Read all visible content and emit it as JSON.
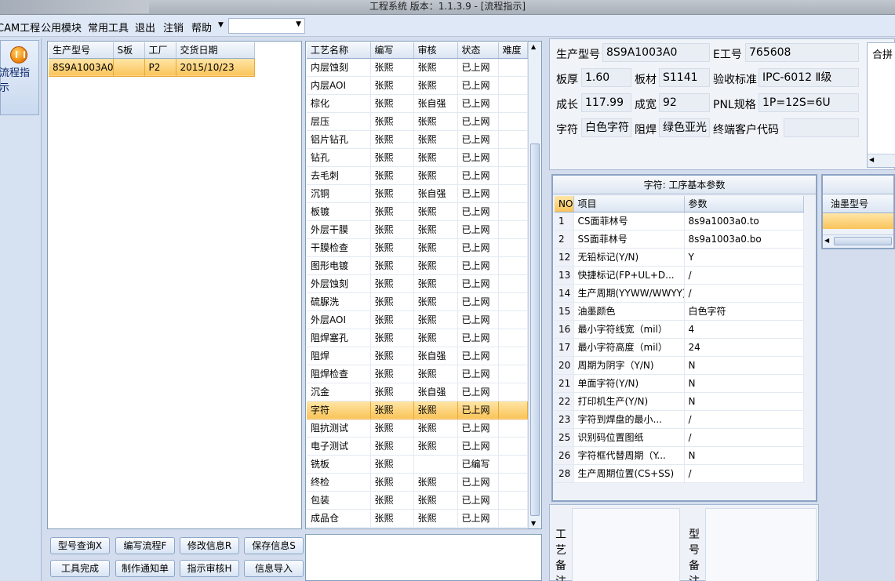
{
  "window": {
    "title": "工程系统   版本：1.1.3.9 - [流程指示]"
  },
  "menu": {
    "items": [
      "CAM工程",
      "公用模块",
      "常用工具",
      "退出",
      "注销",
      "帮助"
    ],
    "combo_value": ""
  },
  "nav": {
    "flow_label": "流程指示"
  },
  "models": {
    "headers": [
      "生产型号",
      "S板",
      "工厂",
      "交货日期"
    ],
    "rows": [
      {
        "model": "8S9A1003A0",
        "s": "",
        "factory": "P2",
        "date": "2015/10/23"
      }
    ]
  },
  "process": {
    "headers": [
      "工艺名称",
      "编写",
      "审核",
      "状态",
      "难度"
    ],
    "selected_index": 19,
    "rows": [
      [
        "内层蚀刻",
        "张熙",
        "张熙",
        "已上网",
        ""
      ],
      [
        "内层AOI",
        "张熙",
        "张熙",
        "已上网",
        ""
      ],
      [
        "棕化",
        "张熙",
        "张自强",
        "已上网",
        ""
      ],
      [
        "层压",
        "张熙",
        "张熙",
        "已上网",
        ""
      ],
      [
        "铝片钻孔",
        "张熙",
        "张熙",
        "已上网",
        ""
      ],
      [
        "钻孔",
        "张熙",
        "张熙",
        "已上网",
        ""
      ],
      [
        "去毛刺",
        "张熙",
        "张熙",
        "已上网",
        ""
      ],
      [
        "沉铜",
        "张熙",
        "张自强",
        "已上网",
        ""
      ],
      [
        "板镀",
        "张熙",
        "张熙",
        "已上网",
        ""
      ],
      [
        "外层干膜",
        "张熙",
        "张熙",
        "已上网",
        ""
      ],
      [
        "干膜检查",
        "张熙",
        "张熙",
        "已上网",
        ""
      ],
      [
        "图形电镀",
        "张熙",
        "张熙",
        "已上网",
        ""
      ],
      [
        "外层蚀刻",
        "张熙",
        "张熙",
        "已上网",
        ""
      ],
      [
        "硫脲洗",
        "张熙",
        "张熙",
        "已上网",
        ""
      ],
      [
        "外层AOI",
        "张熙",
        "张熙",
        "已上网",
        ""
      ],
      [
        "阻焊塞孔",
        "张熙",
        "张熙",
        "已上网",
        ""
      ],
      [
        "阻焊",
        "张熙",
        "张自强",
        "已上网",
        ""
      ],
      [
        "阻焊检查",
        "张熙",
        "张熙",
        "已上网",
        ""
      ],
      [
        "沉金",
        "张熙",
        "张自强",
        "已上网",
        ""
      ],
      [
        "字符",
        "张熙",
        "张熙",
        "已上网",
        ""
      ],
      [
        "阻抗测试",
        "张熙",
        "张熙",
        "已上网",
        ""
      ],
      [
        "电子测试",
        "张熙",
        "张熙",
        "已上网",
        ""
      ],
      [
        "铣板",
        "张熙",
        "",
        "已编写",
        ""
      ],
      [
        "终检",
        "张熙",
        "张熙",
        "已上网",
        ""
      ],
      [
        "包装",
        "张熙",
        "张熙",
        "已上网",
        ""
      ],
      [
        "成品仓",
        "张熙",
        "张熙",
        "已上网",
        ""
      ]
    ]
  },
  "buttons": {
    "model_query": "型号查询X",
    "write_flow": "编写流程F",
    "modify_info": "修改信息R",
    "save_info": "保存信息S",
    "tool_done": "工具完成",
    "make_notice": "制作通知单",
    "review": "指示审核H",
    "import_info": "信息导入"
  },
  "info": {
    "model_label": "生产型号",
    "model_value": "8S9A1003A0",
    "eno_label": "E工号",
    "eno_value": "765608",
    "thickness_label": "板厚",
    "thickness_value": "1.60",
    "material_label": "板材",
    "material_value": "S1141",
    "standard_label": "验收标准",
    "standard_value": "IPC-6012 Ⅱ级",
    "length_label": "成长",
    "length_value": "117.99",
    "width_label": "成宽",
    "width_value": "92",
    "pnl_label": "PNL规格",
    "pnl_value": "1P=12S=6U",
    "char_label": "字符",
    "char_value": "白色字符",
    "mask_label": "阻焊",
    "mask_value": "绿色亚光",
    "customer_label": "终端客户代码",
    "customer_value": "",
    "merge_label": "合拼"
  },
  "params": {
    "title": "字符: 工序基本参数",
    "headers": [
      "NO",
      "项目",
      "参数"
    ],
    "rows": [
      [
        "1",
        "CS面菲林号",
        "8s9a1003a0.to"
      ],
      [
        "2",
        "SS面菲林号",
        "8s9a1003a0.bo"
      ],
      [
        "12",
        "无铅标记(Y/N)",
        "Y"
      ],
      [
        "13",
        "快捷标记(FP+UL+D...",
        "/"
      ],
      [
        "14",
        "生产周期(YYWW/WWYY)",
        "/"
      ],
      [
        "15",
        "油墨颜色",
        "白色字符"
      ],
      [
        "16",
        "最小字符线宽（mil）",
        "4"
      ],
      [
        "17",
        "最小字符高度（mil）",
        "24"
      ],
      [
        "20",
        "周期为阴字（Y/N)",
        "N"
      ],
      [
        "21",
        "单面字符(Y/N)",
        "N"
      ],
      [
        "22",
        "打印机生产(Y/N)",
        "N"
      ],
      [
        "23",
        "字符到焊盘的最小...",
        "/"
      ],
      [
        "25",
        "识别码位置图纸",
        "/"
      ],
      [
        "26",
        "字符框代替周期（Y...",
        "N"
      ],
      [
        "28",
        "生产周期位置(CS+SS)",
        "/"
      ]
    ]
  },
  "ink": {
    "header": "油墨型号"
  },
  "notes": {
    "process_note": "工艺备注",
    "model_note": "型号备注"
  }
}
